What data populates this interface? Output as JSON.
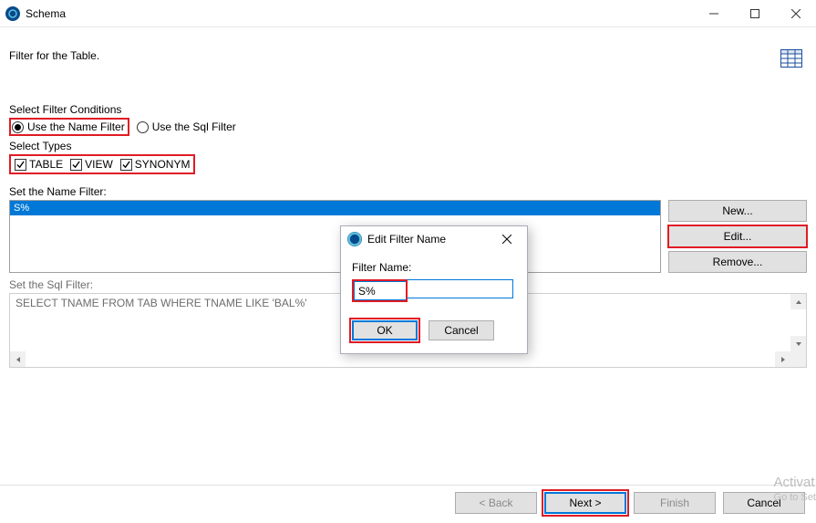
{
  "window": {
    "title": "Schema"
  },
  "header": {
    "heading": "Filter for the Table."
  },
  "conditions": {
    "label": "Select Filter Conditions",
    "use_name": "Use the Name Filter",
    "use_sql": "Use the Sql Filter"
  },
  "types": {
    "label": "Select Types",
    "table": "TABLE",
    "view": "VIEW",
    "synonym": "SYNONYM"
  },
  "name_filter": {
    "label": "Set the Name Filter:",
    "items": [
      "S%"
    ],
    "btn_new": "New...",
    "btn_edit": "Edit...",
    "btn_remove": "Remove..."
  },
  "sql_filter": {
    "label": "Set the Sql Filter:",
    "text": "SELECT TNAME FROM TAB WHERE TNAME LIKE 'BAL%'"
  },
  "footer": {
    "back": "< Back",
    "next": "Next >",
    "finish": "Finish",
    "cancel": "Cancel"
  },
  "modal": {
    "title": "Edit Filter Name",
    "label": "Filter Name:",
    "value": "S%",
    "ok": "OK",
    "cancel": "Cancel"
  },
  "watermark": {
    "line1": "Activat",
    "line2": "Go to Set"
  }
}
